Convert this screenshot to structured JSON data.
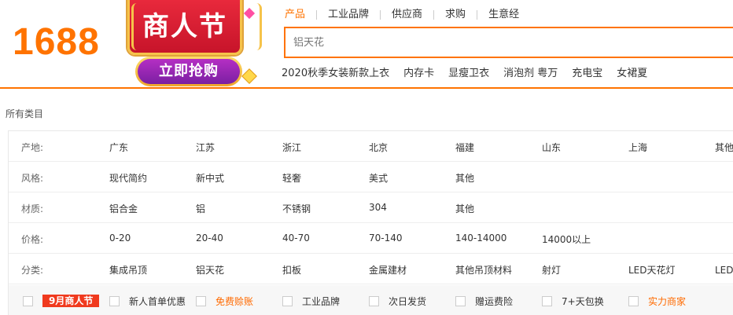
{
  "header": {
    "logo": "1688",
    "promo": {
      "title": "商人节",
      "button": "立即抢购"
    },
    "tabs": [
      "产品",
      "工业品牌",
      "供应商",
      "求购",
      "生意经"
    ],
    "search_placeholder": "铝天花",
    "hot_words": [
      "2020秋季女装新款上衣",
      "内存卡",
      "显瘦卫衣",
      "消泡剂 粤万",
      "充电宝",
      "女裙夏"
    ]
  },
  "all_categories_label": "所有类目",
  "filters": {
    "origin": {
      "label": "产地:",
      "items": [
        "广东",
        "江苏",
        "浙江",
        "北京",
        "福建",
        "山东",
        "上海",
        "其他"
      ]
    },
    "style": {
      "label": "风格:",
      "items": [
        "现代简约",
        "新中式",
        "轻奢",
        "美式",
        "其他"
      ]
    },
    "material": {
      "label": "材质:",
      "items": [
        "铝合金",
        "铝",
        "不锈钢",
        "304",
        "其他"
      ]
    },
    "price": {
      "label": "价格:",
      "items": [
        "0-20",
        "20-40",
        "40-70",
        "70-140",
        "140-14000",
        "14000以上"
      ]
    },
    "category": {
      "label": "分类:",
      "items": [
        "集成吊顶",
        "铝天花",
        "扣板",
        "金属建材",
        "其他吊顶材料",
        "射灯",
        "LED天花灯",
        "LED天"
      ]
    }
  },
  "checkboxes": {
    "badge": "9月商人节",
    "items": [
      "新人首单优惠",
      "免费赊账",
      "工业品牌",
      "次日发货",
      "赠运费险",
      "7+天包换",
      "实力商家"
    ]
  },
  "colors": {
    "accent": "#ff7300",
    "badge": "#f03a1e"
  }
}
